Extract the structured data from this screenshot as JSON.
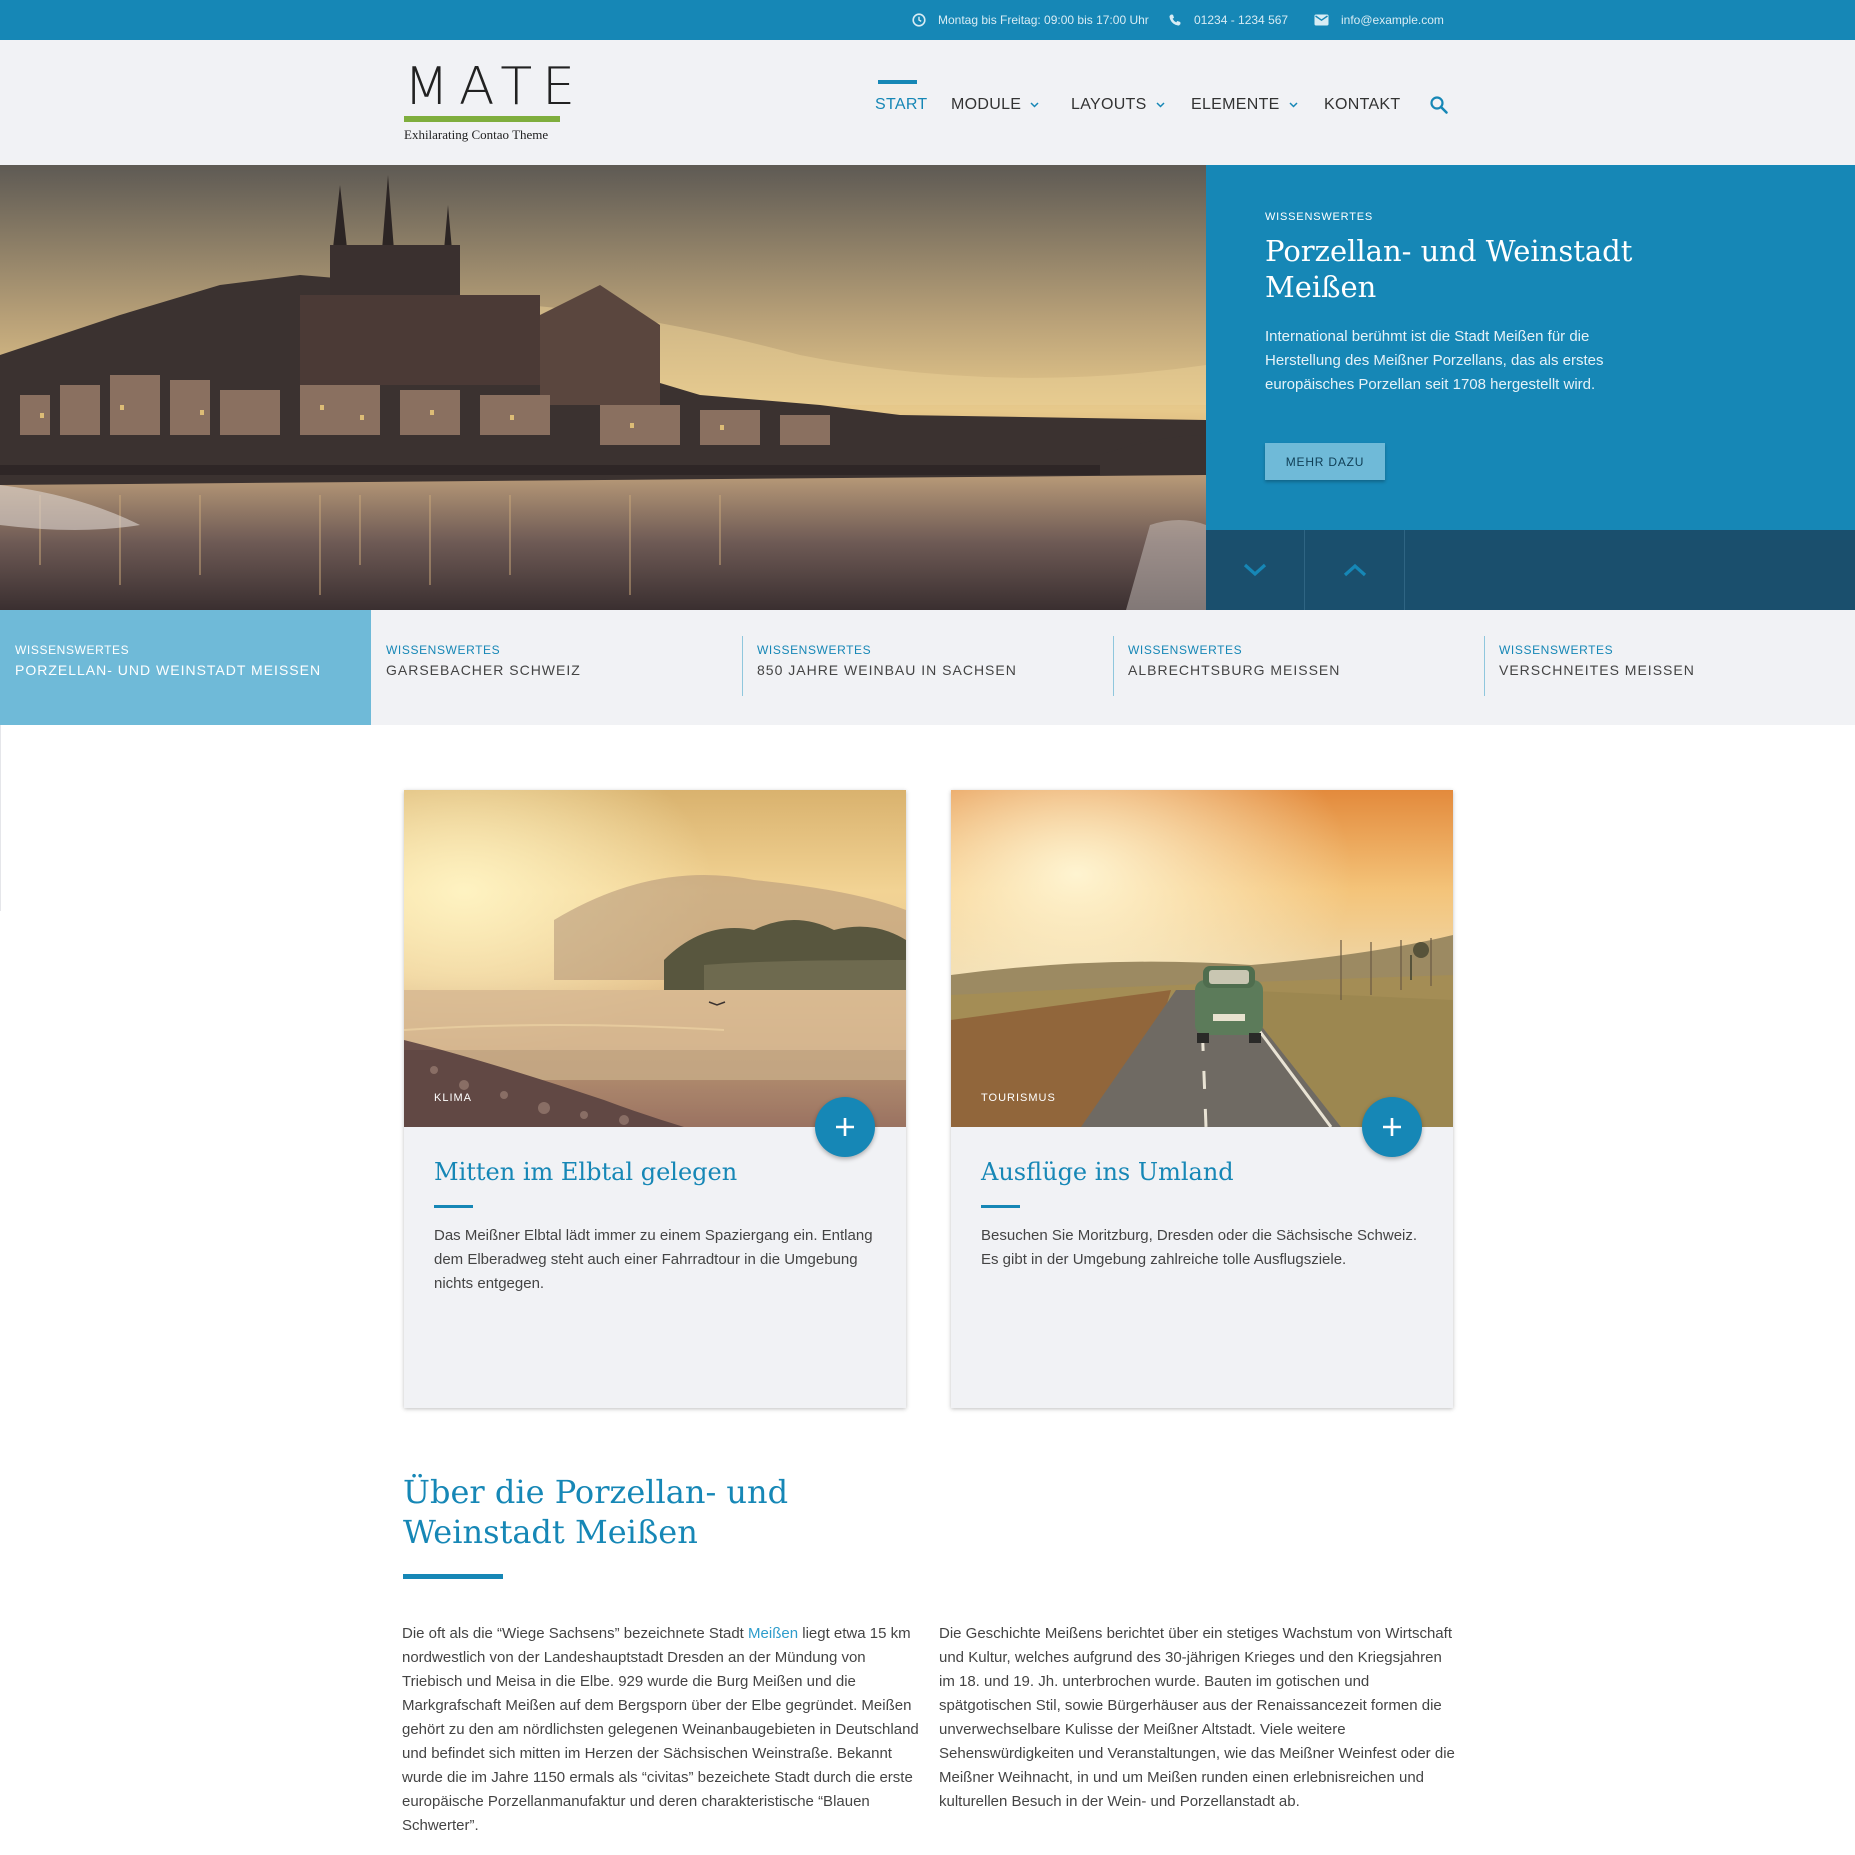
{
  "topbar": {
    "hours": "Montag bis Freitag: 09:00 bis 17:00 Uhr",
    "phone": "01234 - 1234 567",
    "email": "info@example.com"
  },
  "logo": {
    "word": "MATE",
    "tagline": "Exhilarating Contao Theme"
  },
  "nav": {
    "items": [
      {
        "label": "START",
        "active": true
      },
      {
        "label": "MODULE",
        "has_dropdown": true
      },
      {
        "label": "LAYOUTS",
        "has_dropdown": true
      },
      {
        "label": "ELEMENTE",
        "has_dropdown": true
      },
      {
        "label": "KONTAKT"
      }
    ],
    "search_icon": "search-icon"
  },
  "hero": {
    "kicker": "WISSENSWERTES",
    "title": "Porzellan- und Weinstadt Meißen",
    "text": "International berühmt ist die Stadt Meißen für die Herstellung des Meißner Porzellans, das als erstes europäisches Porzellan seit 1708 hergestellt wird.",
    "button": "MEHR DAZU"
  },
  "tabs": [
    {
      "kicker": "WISSENSWERTES",
      "title": "PORZELLAN- UND WEINSTADT MEISSEN",
      "active": true
    },
    {
      "kicker": "WISSENSWERTES",
      "title": "GARSEBACHER SCHWEIZ"
    },
    {
      "kicker": "WISSENSWERTES",
      "title": "850 JAHRE WEINBAU IN SACHSEN"
    },
    {
      "kicker": "WISSENSWERTES",
      "title": "ALBRECHTSBURG MEISSEN"
    },
    {
      "kicker": "WISSENSWERTES",
      "title": "VERSCHNEITES MEISSEN"
    }
  ],
  "cards": [
    {
      "tag": "KLIMA",
      "title": "Mitten im Elbtal gelegen",
      "text": "Das Meißner Elbtal lädt immer zu einem Spaziergang ein. Entlang dem Elberadweg steht auch einer Fahrradtour in die Umgebung nichts entgegen."
    },
    {
      "tag": "TOURISMUS",
      "title": "Ausflüge ins Umland",
      "text": "Besuchen Sie Moritzburg, Dresden oder die Sächsische Schweiz. Es gibt in der Umgebung zahlreiche tolle Ausflugsziele."
    }
  ],
  "about": {
    "title": "Über die Porzellan- und Weinstadt Meißen",
    "left_before_link": "Die oft als die “Wiege Sachsens” bezeichnete Stadt ",
    "left_link": "Meißen",
    "left_after_link": " liegt etwa 15 km nordwestlich von der Landeshauptstadt Dresden an der Mündung von Triebisch und Meisa in die Elbe. 929 wurde die Burg Meißen und die Markgrafschaft Meißen auf dem Bergsporn über der Elbe gegründet. Meißen gehört zu den am nördlichsten gelegenen Weinanbaugebieten in Deutschland und befindet sich mitten im Herzen der Sächsischen Weinstraße. Bekannt wurde die im Jahre 1150 ermals als “civitas” bezeichete Stadt durch die erste europäische Porzellanmanufaktur und deren charakteristische “Blauen Schwerter”.",
    "right": "Die Geschichte Meißens berichtet über ein stetiges Wachstum von Wirtschaft und Kultur, welches aufgrund des 30-jährigen Krieges und den Kriegsjahren im 18. und 19. Jh. unterbrochen wurde. Bauten im gotischen und spätgotischen Stil, sowie Bürgerhäuser aus der Renaissancezeit formen die unverwechselbare Kulisse der Meißner Altstadt. Viele weitere Sehenswürdigkeiten und Veranstaltungen, wie das Meißner Weinfest oder die Meißner Weihnacht, in und um Meißen runden einen erlebnisreichen und kulturellen Besuch in der Wein- und Porzellanstadt ab."
  },
  "colors": {
    "brand_blue": "#1687b6",
    "light_blue": "#6fbad8",
    "dark_blue": "#1a4f6d",
    "logo_green": "#7fae3d",
    "panel_grey": "#f1f2f5"
  }
}
